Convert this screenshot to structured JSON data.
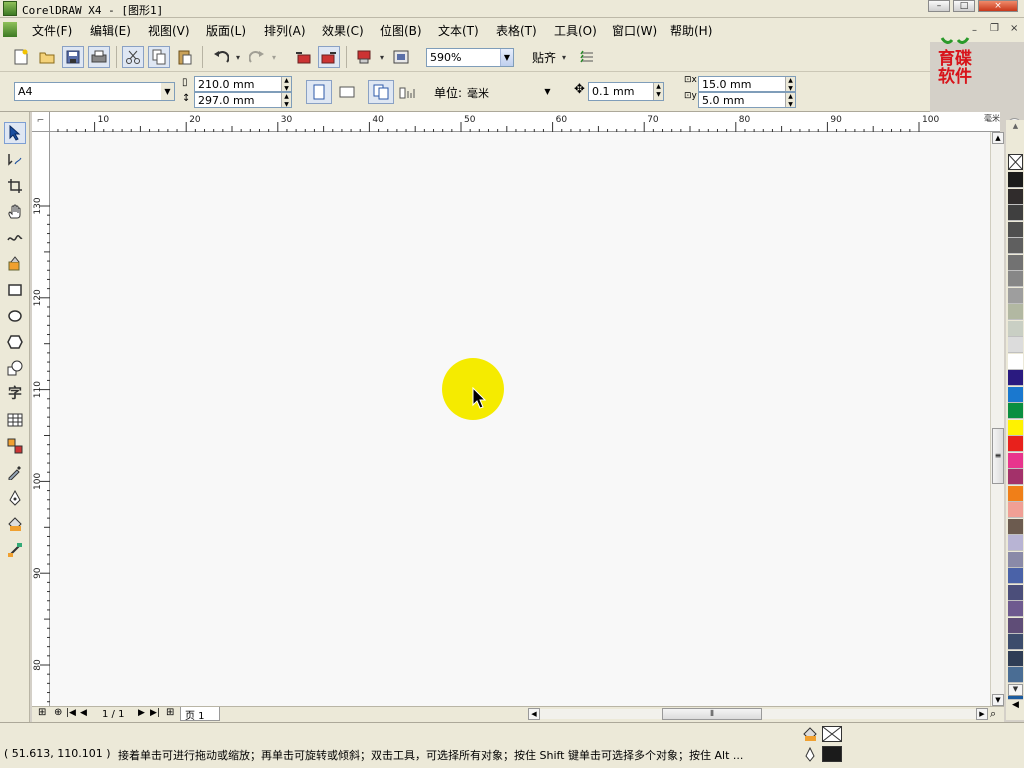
{
  "window": {
    "title": "CorelDRAW X4 - [图形1]",
    "controls": [
      "–",
      "□",
      "×"
    ],
    "doc_controls": [
      "–",
      "❐",
      "×"
    ]
  },
  "menu": [
    {
      "label": "文件(F)"
    },
    {
      "label": "编辑(E)"
    },
    {
      "label": "视图(V)"
    },
    {
      "label": "版面(L)"
    },
    {
      "label": "排列(A)"
    },
    {
      "label": "效果(C)"
    },
    {
      "label": "位图(B)"
    },
    {
      "label": "文本(T)"
    },
    {
      "label": "表格(T)"
    },
    {
      "label": "工具(O)"
    },
    {
      "label": "窗口(W)"
    },
    {
      "label": "帮助(H)"
    }
  ],
  "standard_toolbar": {
    "zoom": "590%",
    "snap_label": "贴齐"
  },
  "property_bar": {
    "paper_size": "A4",
    "width": "210.0 mm",
    "height": "297.0 mm",
    "unit_label": "单位:",
    "unit_value": "毫米",
    "nudge": "0.1 mm",
    "dup_x": "15.0 mm",
    "dup_y": "5.0 mm"
  },
  "logo": {
    "text_top": "育碟",
    "text_bottom": "软件",
    "accent": "#d8141b"
  },
  "toolbox": {
    "text_tool_glyph": "字"
  },
  "rulers": {
    "units_label": "毫米",
    "horizontal_ticks": [
      "10",
      "20",
      "30",
      "40",
      "50",
      "60",
      "70",
      "80",
      "90",
      "100"
    ],
    "vertical_ticks": [
      "130",
      "120",
      "110",
      "100",
      "90",
      "80"
    ]
  },
  "page_nav": {
    "counter": "1 / 1",
    "page_tab": "页 1"
  },
  "palette": {
    "colors": [
      "#1b1b1b",
      "#302c2c",
      "#3f3f3f",
      "#4f4f4f",
      "#5f5f5f",
      "#727272",
      "#878787",
      "#9e9e9e",
      "#b2b8a2",
      "#c9cfc4",
      "#dcdcdc",
      "#ffffff",
      "#2a1a80",
      "#1a78cf",
      "#0a8f40",
      "#fff200",
      "#e8211c",
      "#e8348d",
      "#a3316a",
      "#f07f18",
      "#f09f95",
      "#6c5b4f",
      "#b8b4d4",
      "#8a8aa8",
      "#4a62a8",
      "#4b4e7a",
      "#6e5a8f",
      "#5f4d77",
      "#3c4c6c",
      "#2f3d55",
      "#4a6d94",
      "#1a5a9e"
    ]
  },
  "status": {
    "coordinates": "( 51.613, 110.101 )",
    "message": "接着单击可进行拖动或缩放；再单击可旋转或倾斜；双击工具，可选择所有对象；按住 Shift 键单击可选择多个对象；按住 Alt ..."
  }
}
